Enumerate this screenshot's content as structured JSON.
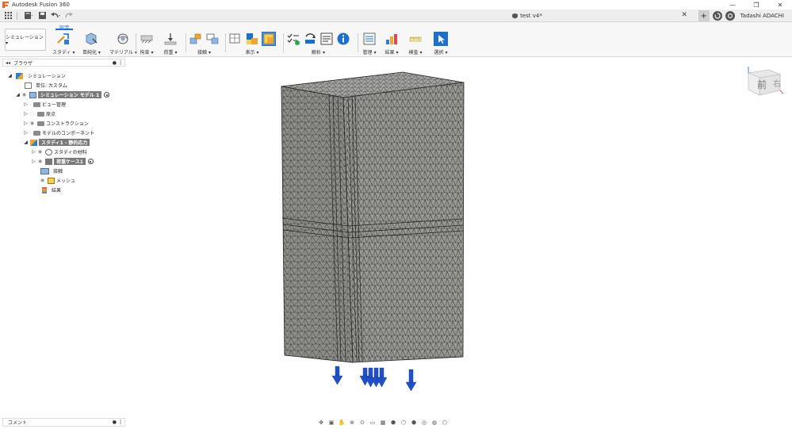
{
  "window": {
    "app_title": "Autodesk Fusion 360",
    "minimize": "—",
    "maximize": "❐",
    "close": "✕"
  },
  "tabbar": {
    "doc_title": "test v4*",
    "close": "✕",
    "add_tab": "+",
    "user_name": "Tadashi ADACHI"
  },
  "ribbon": {
    "workspace": "シミュレーション ▾",
    "active_tab": "設定",
    "groups": [
      {
        "label": "スタディ ▾"
      },
      {
        "label": "単純化 ▾"
      },
      {
        "label": "マテリアル ▾"
      },
      {
        "label": "拘束 ▾"
      },
      {
        "label": "荷重 ▾"
      },
      {
        "label": "接触 ▾"
      },
      {
        "label": "表示 ▾"
      },
      {
        "label": "解析 ▾"
      },
      {
        "label": "管理 ▾"
      },
      {
        "label": "結果 ▾"
      },
      {
        "label": "検査 ▾"
      },
      {
        "label": "選択 ▾"
      }
    ]
  },
  "browser": {
    "title": "ブラウザ",
    "items": [
      {
        "label": "シミュレーション"
      },
      {
        "label": "単位: カスタム"
      },
      {
        "label": "シミュレーション モデル 1"
      },
      {
        "label": "ビュー管理"
      },
      {
        "label": "原点"
      },
      {
        "label": "コンストラクション"
      },
      {
        "label": "モデルのコンポーネント"
      },
      {
        "label": "スタディ1 - 静的応力"
      },
      {
        "label": "スタディの材料"
      },
      {
        "label": "荷重ケース1"
      },
      {
        "label": "接触"
      },
      {
        "label": "メッシュ"
      },
      {
        "label": "結果"
      }
    ]
  },
  "comments": {
    "title": "コメント"
  },
  "viewcube": {
    "face_label": "前",
    "side_label": "右"
  },
  "colors": {
    "accent": "#1a6fd1",
    "mesh_face": "#8c8c88",
    "mesh_line": "#2d2d2d",
    "load_arrow": "#1f52c9"
  }
}
